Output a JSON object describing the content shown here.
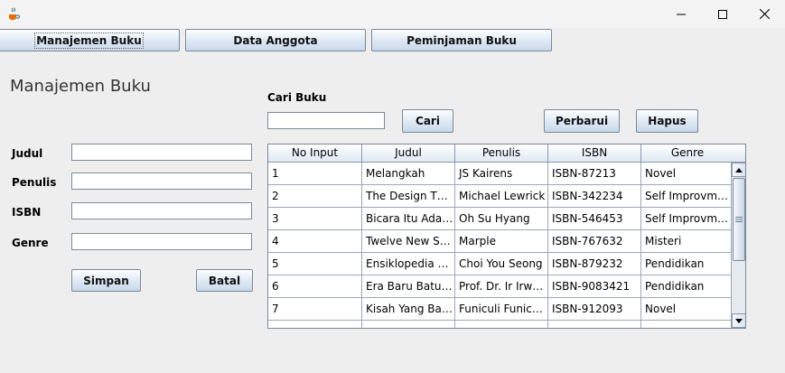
{
  "window": {
    "app_icon": "java-coffee-cup-icon",
    "controls": {
      "minimize": "minimize-icon",
      "maximize": "maximize-icon",
      "close": "close-icon"
    }
  },
  "nav": {
    "buku": "Manajemen Buku",
    "anggota": "Data Anggota",
    "peminjaman": "Peminjaman Buku"
  },
  "form": {
    "title": "Manajemen Buku",
    "judul_label": "Judul",
    "penulis_label": "Penulis",
    "isbn_label": "ISBN",
    "genre_label": "Genre",
    "judul_value": "",
    "penulis_value": "",
    "isbn_value": "",
    "genre_value": "",
    "simpan": "Simpan",
    "batal": "Batal"
  },
  "search": {
    "label": "Cari Buku",
    "value": "",
    "cari": "Cari",
    "perbarui": "Perbarui",
    "hapus": "Hapus"
  },
  "table": {
    "columns": [
      "No Input",
      "Judul",
      "Penulis",
      "ISBN",
      "Genre"
    ],
    "rows": [
      [
        "1",
        "Melangkah",
        "JS Kairens",
        "ISBN-87213",
        "Novel"
      ],
      [
        "2",
        "The Design Thi...",
        "Michael Lewrick",
        "ISBN-342234",
        "Self Improvment"
      ],
      [
        "3",
        "Bicara Itu Ada S...",
        "Oh Su Hyang",
        "ISBN-546453",
        "Self Improvment"
      ],
      [
        "4",
        "Twelve New Sto...",
        "Marple",
        "ISBN-767632",
        "Misteri"
      ],
      [
        "5",
        "Ensiklopedia A...",
        "Choi You Seong",
        "ISBN-879232",
        "Pendidikan"
      ],
      [
        "6",
        "Era Baru Batub...",
        "Prof. Dr. Ir Irwa...",
        "ISBN-9083421",
        "Pendidikan"
      ],
      [
        "7",
        "Kisah Yang Bar...",
        "Funiculi Funicula",
        "ISBN-912093",
        "Novel"
      ],
      [
        "",
        "",
        "",
        "",
        ""
      ]
    ]
  },
  "colors": {
    "background": "#eeeeee",
    "button_gradient_top": "#fdfeff",
    "button_gradient_bottom": "#c8d8ea",
    "border": "#7a8a99"
  }
}
